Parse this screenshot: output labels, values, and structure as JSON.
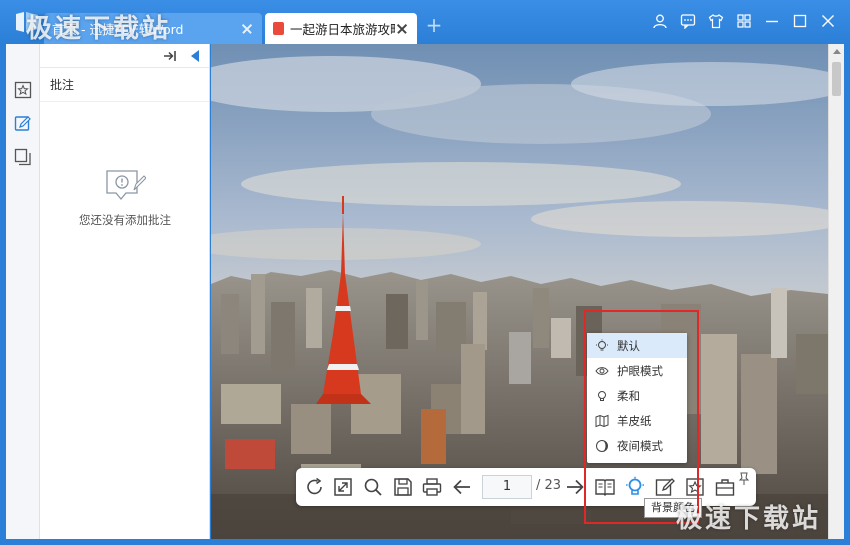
{
  "app": {
    "tabs": [
      {
        "label": "首页 - 迅捷PDF转Word"
      },
      {
        "label": "一起游日本旅游攻略..."
      }
    ],
    "new_tab": "+"
  },
  "watermark": {
    "top": "极速下载站",
    "bottom": "极速下载站"
  },
  "titlebar_icons": [
    "user-icon",
    "chat-icon",
    "shirt-icon",
    "grid-icon",
    "minimize-icon",
    "maximize-icon",
    "close-icon"
  ],
  "side_panel": {
    "title": "批注",
    "empty_text": "您还没有添加批注"
  },
  "toolbar": {
    "current_page": "1",
    "total_pages": "/ 23",
    "tooltip": "背景颜色"
  },
  "mode_menu": {
    "items": [
      {
        "label": "默认",
        "icon": "bulb-icon",
        "active": true
      },
      {
        "label": "护眼模式",
        "icon": "eye-icon",
        "active": false
      },
      {
        "label": "柔和",
        "icon": "bulb-soft-icon",
        "active": false
      },
      {
        "label": "羊皮纸",
        "icon": "map-icon",
        "active": false
      },
      {
        "label": "夜间模式",
        "icon": "moon-icon",
        "active": false
      }
    ]
  },
  "colors": {
    "titlebar": "#2b7fd6",
    "accent": "#2b7fd6",
    "highlight": "#e02828"
  }
}
